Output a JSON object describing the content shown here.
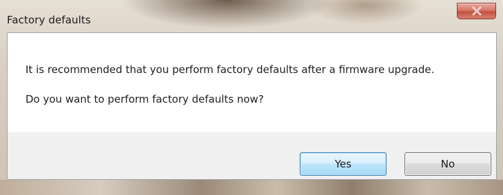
{
  "window": {
    "title": "Factory defaults"
  },
  "message": {
    "line1": "It is recommended that you perform factory defaults after a firmware upgrade.",
    "line2": "Do you want to perform factory defaults now?"
  },
  "buttons": {
    "yes_label": "Yes",
    "no_label": "No"
  },
  "icons": {
    "close": "close-icon"
  },
  "colors": {
    "close_button": "#c4513f",
    "default_button_border": "#3c7fb1",
    "client_background": "#f0f0f0",
    "content_background": "#ffffff"
  }
}
